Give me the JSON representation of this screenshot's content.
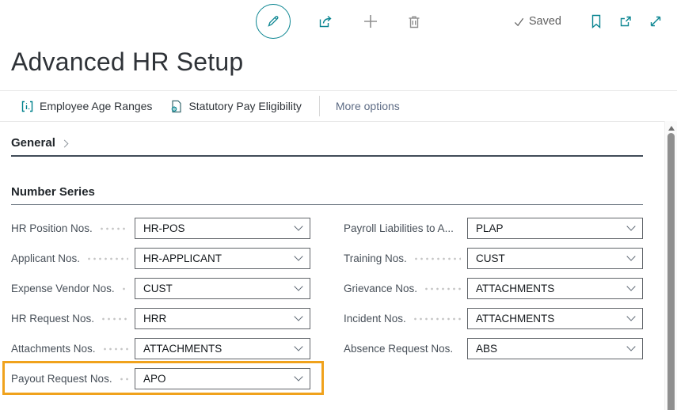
{
  "colors": {
    "accent_teal": "#00818c",
    "icon_gray": "#8f8f8f",
    "highlight_orange": "#f0a21c"
  },
  "toolbar": {
    "saved_label": "Saved",
    "icons": [
      "edit",
      "share",
      "new",
      "delete",
      "bookmark",
      "open-in-new-window",
      "expand"
    ]
  },
  "page": {
    "title": "Advanced HR Setup"
  },
  "action_bar": {
    "actions": [
      {
        "label": "Employee Age Ranges",
        "icon": "employee-age-ranges-icon"
      },
      {
        "label": "Statutory Pay Eligibility",
        "icon": "statutory-pay-eligibility-icon"
      }
    ],
    "more_options_label": "More options"
  },
  "sections": {
    "general": {
      "label": "General",
      "collapsed": true
    },
    "number_series": {
      "label": "Number Series",
      "left_fields": [
        {
          "label": "HR Position Nos.",
          "value": "HR-POS",
          "highlighted": false
        },
        {
          "label": "Applicant Nos.",
          "value": "HR-APPLICANT",
          "highlighted": false
        },
        {
          "label": "Expense Vendor Nos.",
          "value": "CUST",
          "highlighted": false
        },
        {
          "label": "HR Request Nos.",
          "value": "HRR",
          "highlighted": false
        },
        {
          "label": "Attachments Nos.",
          "value": "ATTACHMENTS",
          "highlighted": false
        },
        {
          "label": "Payout Request Nos.",
          "value": "APO",
          "highlighted": true
        }
      ],
      "right_fields": [
        {
          "label": "Payroll Liabilities to A...",
          "value": "PLAP",
          "highlighted": false
        },
        {
          "label": "Training Nos.",
          "value": "CUST",
          "highlighted": false
        },
        {
          "label": "Grievance Nos.",
          "value": "ATTACHMENTS",
          "highlighted": false
        },
        {
          "label": "Incident Nos.",
          "value": "ATTACHMENTS",
          "highlighted": false
        },
        {
          "label": "Absence Request Nos.",
          "value": "ABS",
          "highlighted": false
        }
      ]
    }
  }
}
